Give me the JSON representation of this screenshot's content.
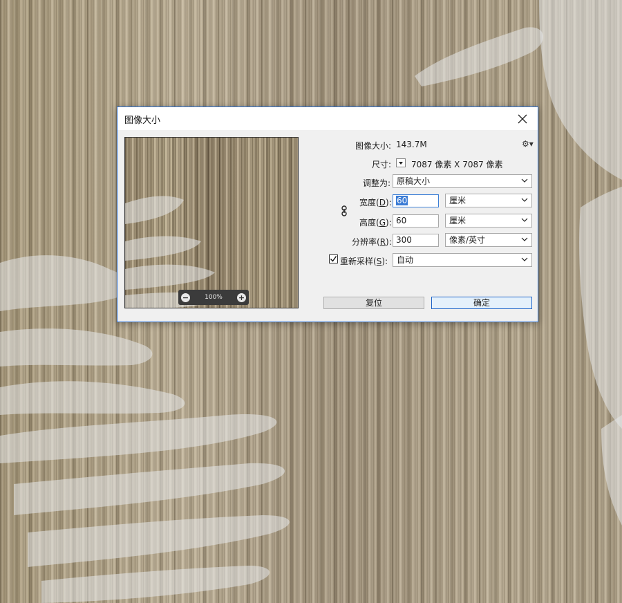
{
  "dialog": {
    "title": "图像大小",
    "close_icon": "close-icon",
    "preview": {
      "zoom_level": "100%"
    },
    "image_size_label": "图像大小:",
    "image_size_value": "143.7M",
    "gear_icon": "gear-icon",
    "dimensions_label": "尺寸:",
    "dimensions_value": "7087 像素  X  7087 像素",
    "fit_to_label": "调整为:",
    "fit_to_value": "原稿大小",
    "width_label": "宽度",
    "width_key": "D",
    "width_value": "60",
    "width_unit": "厘米",
    "height_label": "高度",
    "height_key": "G",
    "height_value": "60",
    "height_unit": "厘米",
    "resolution_label": "分辨率",
    "resolution_key": "R",
    "resolution_value": "300",
    "resolution_unit": "像素/英寸",
    "resample_label": "重新采样",
    "resample_key": "S",
    "resample_checked": true,
    "resample_value": "自动",
    "reset_button": "复位",
    "ok_button": "确定",
    "link_icon": "link-icon"
  },
  "colors": {
    "accent": "#1e64c8",
    "selection": "#3a7bd5",
    "dialog_bg": "#f0f0f0"
  }
}
